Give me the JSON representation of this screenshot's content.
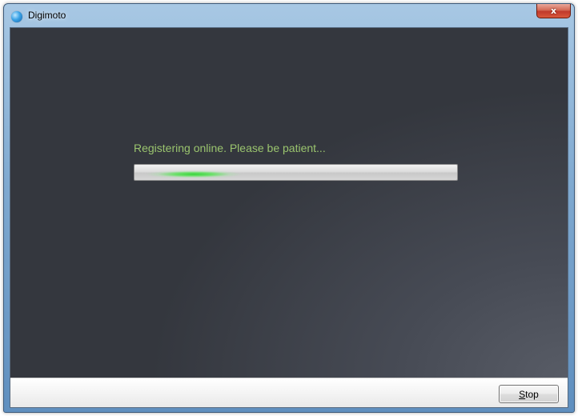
{
  "window": {
    "title": "Digimoto",
    "app_icon": "globe-icon",
    "close_icon": "close-icon",
    "close_glyph": "x"
  },
  "main": {
    "status_text": "Registering online. Please be patient...",
    "progress": {
      "mode": "indeterminate",
      "accent_color": "#2ecc40"
    }
  },
  "footer": {
    "stop_button": {
      "mnemonic": "S",
      "label_rest": "top"
    }
  }
}
